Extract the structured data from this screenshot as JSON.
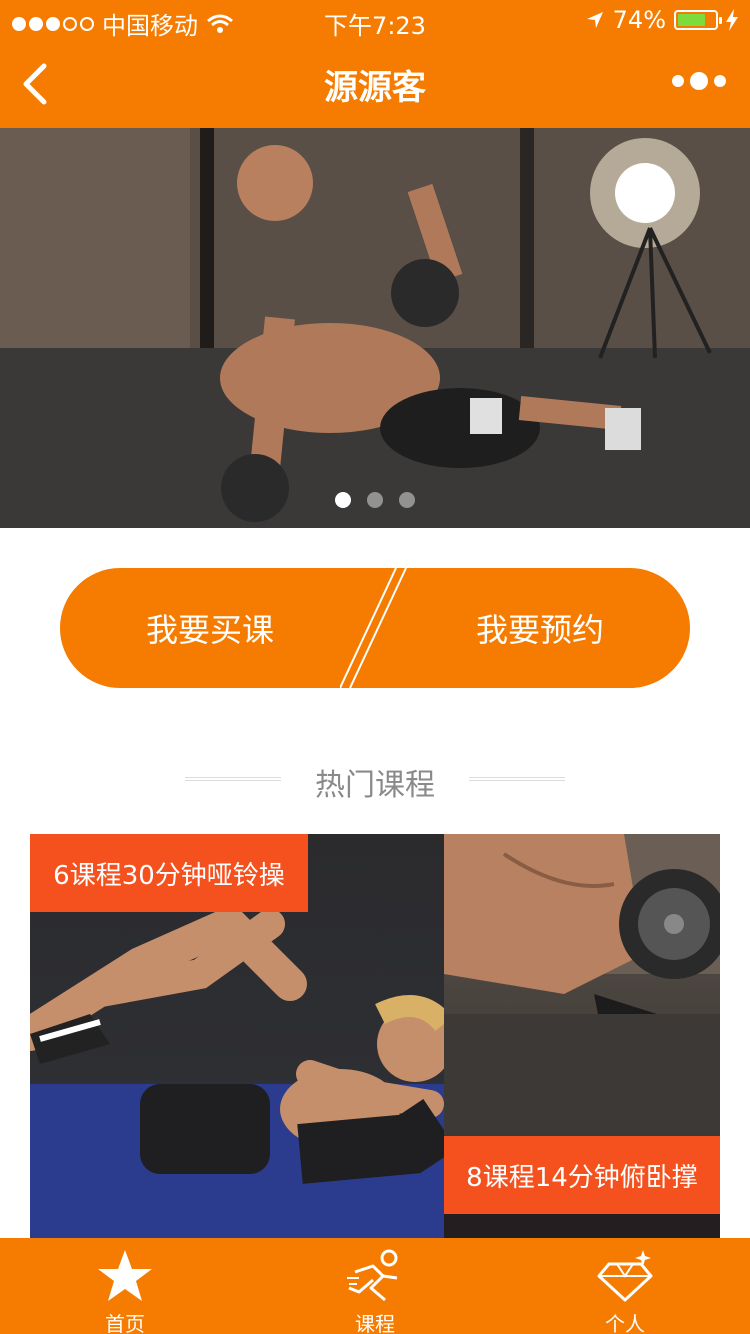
{
  "status_bar": {
    "carrier": "中国移动",
    "time": "下午7:23",
    "battery": "74%",
    "battery_level": 0.74
  },
  "nav": {
    "title": "源源客"
  },
  "banner": {
    "page_count": 3,
    "active_page": 1
  },
  "actions": {
    "buy_label": "我要买课",
    "book_label": "我要预约"
  },
  "section": {
    "title": "热门课程"
  },
  "courses": [
    {
      "label": "6课程30分钟哑铃操"
    },
    {
      "label": "8课程14分钟俯卧撑"
    }
  ],
  "tabs": [
    {
      "label": "首页",
      "icon": "star-icon"
    },
    {
      "label": "课程",
      "icon": "running-figure-icon"
    },
    {
      "label": "个人",
      "icon": "diamond-icon"
    }
  ],
  "colors": {
    "brand_orange": "#f57c00",
    "label_red": "#f4511e"
  }
}
